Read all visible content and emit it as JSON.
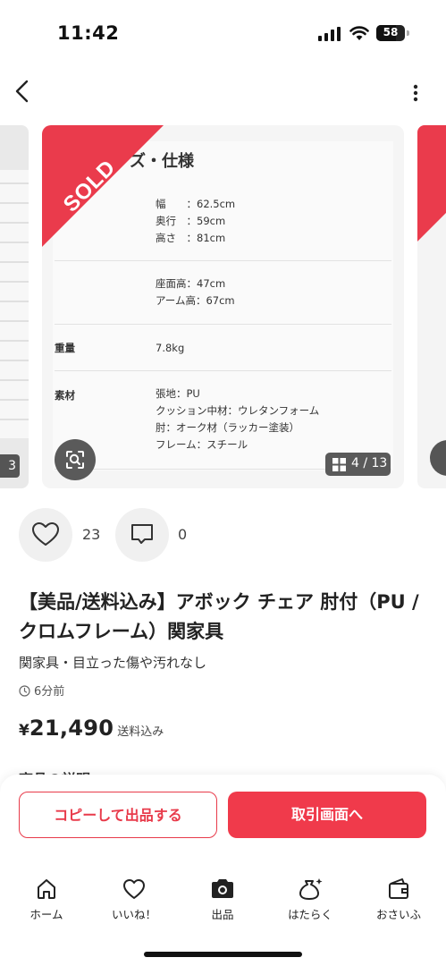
{
  "status_bar": {
    "time": "11:42",
    "battery": "58"
  },
  "carousel": {
    "current_card": {
      "heading": "ズ・仕様",
      "sold_label": "SOLD",
      "size_values": [
        "幅　　：62.5cm",
        "奥行　：59cm",
        "高さ　：81cm"
      ],
      "seat_values": [
        "座面高：47cm",
        "アーム高：67cm"
      ],
      "weight_label": "重量",
      "weight_value": "7.8kg",
      "material_label": "素材",
      "material_values": [
        "張地：PU",
        "クッション中材：ウレタンフォーム",
        "肘：オーク材（ラッカー塗装）",
        "フレーム：スチール"
      ]
    },
    "left_counter": "3",
    "counter": "4 / 13"
  },
  "actions": {
    "likes": "23",
    "comments": "0"
  },
  "item": {
    "title": "【美品/送料込み】アボック チェア 肘付（PU / クロムフレーム）関家具",
    "subtitle": "関家具・目立った傷や汚れなし",
    "posted": "6分前",
    "price_symbol": "¥",
    "price": "21,490",
    "shipping_note": "送料込み",
    "description_heading": "商品の説明"
  },
  "buttons": {
    "copy": "コピーして出品する",
    "deal": "取引画面へ"
  },
  "tabs": [
    {
      "label": "ホーム",
      "icon": "home-icon"
    },
    {
      "label": "いいね！",
      "icon": "heart-icon"
    },
    {
      "label": "出品",
      "icon": "camera-icon"
    },
    {
      "label": "はたらく",
      "icon": "bag-sparkle-icon"
    },
    {
      "label": "おさいふ",
      "icon": "wallet-icon"
    }
  ],
  "colors": {
    "accent": "#f03a4b",
    "sold": "#ea3b4c"
  }
}
